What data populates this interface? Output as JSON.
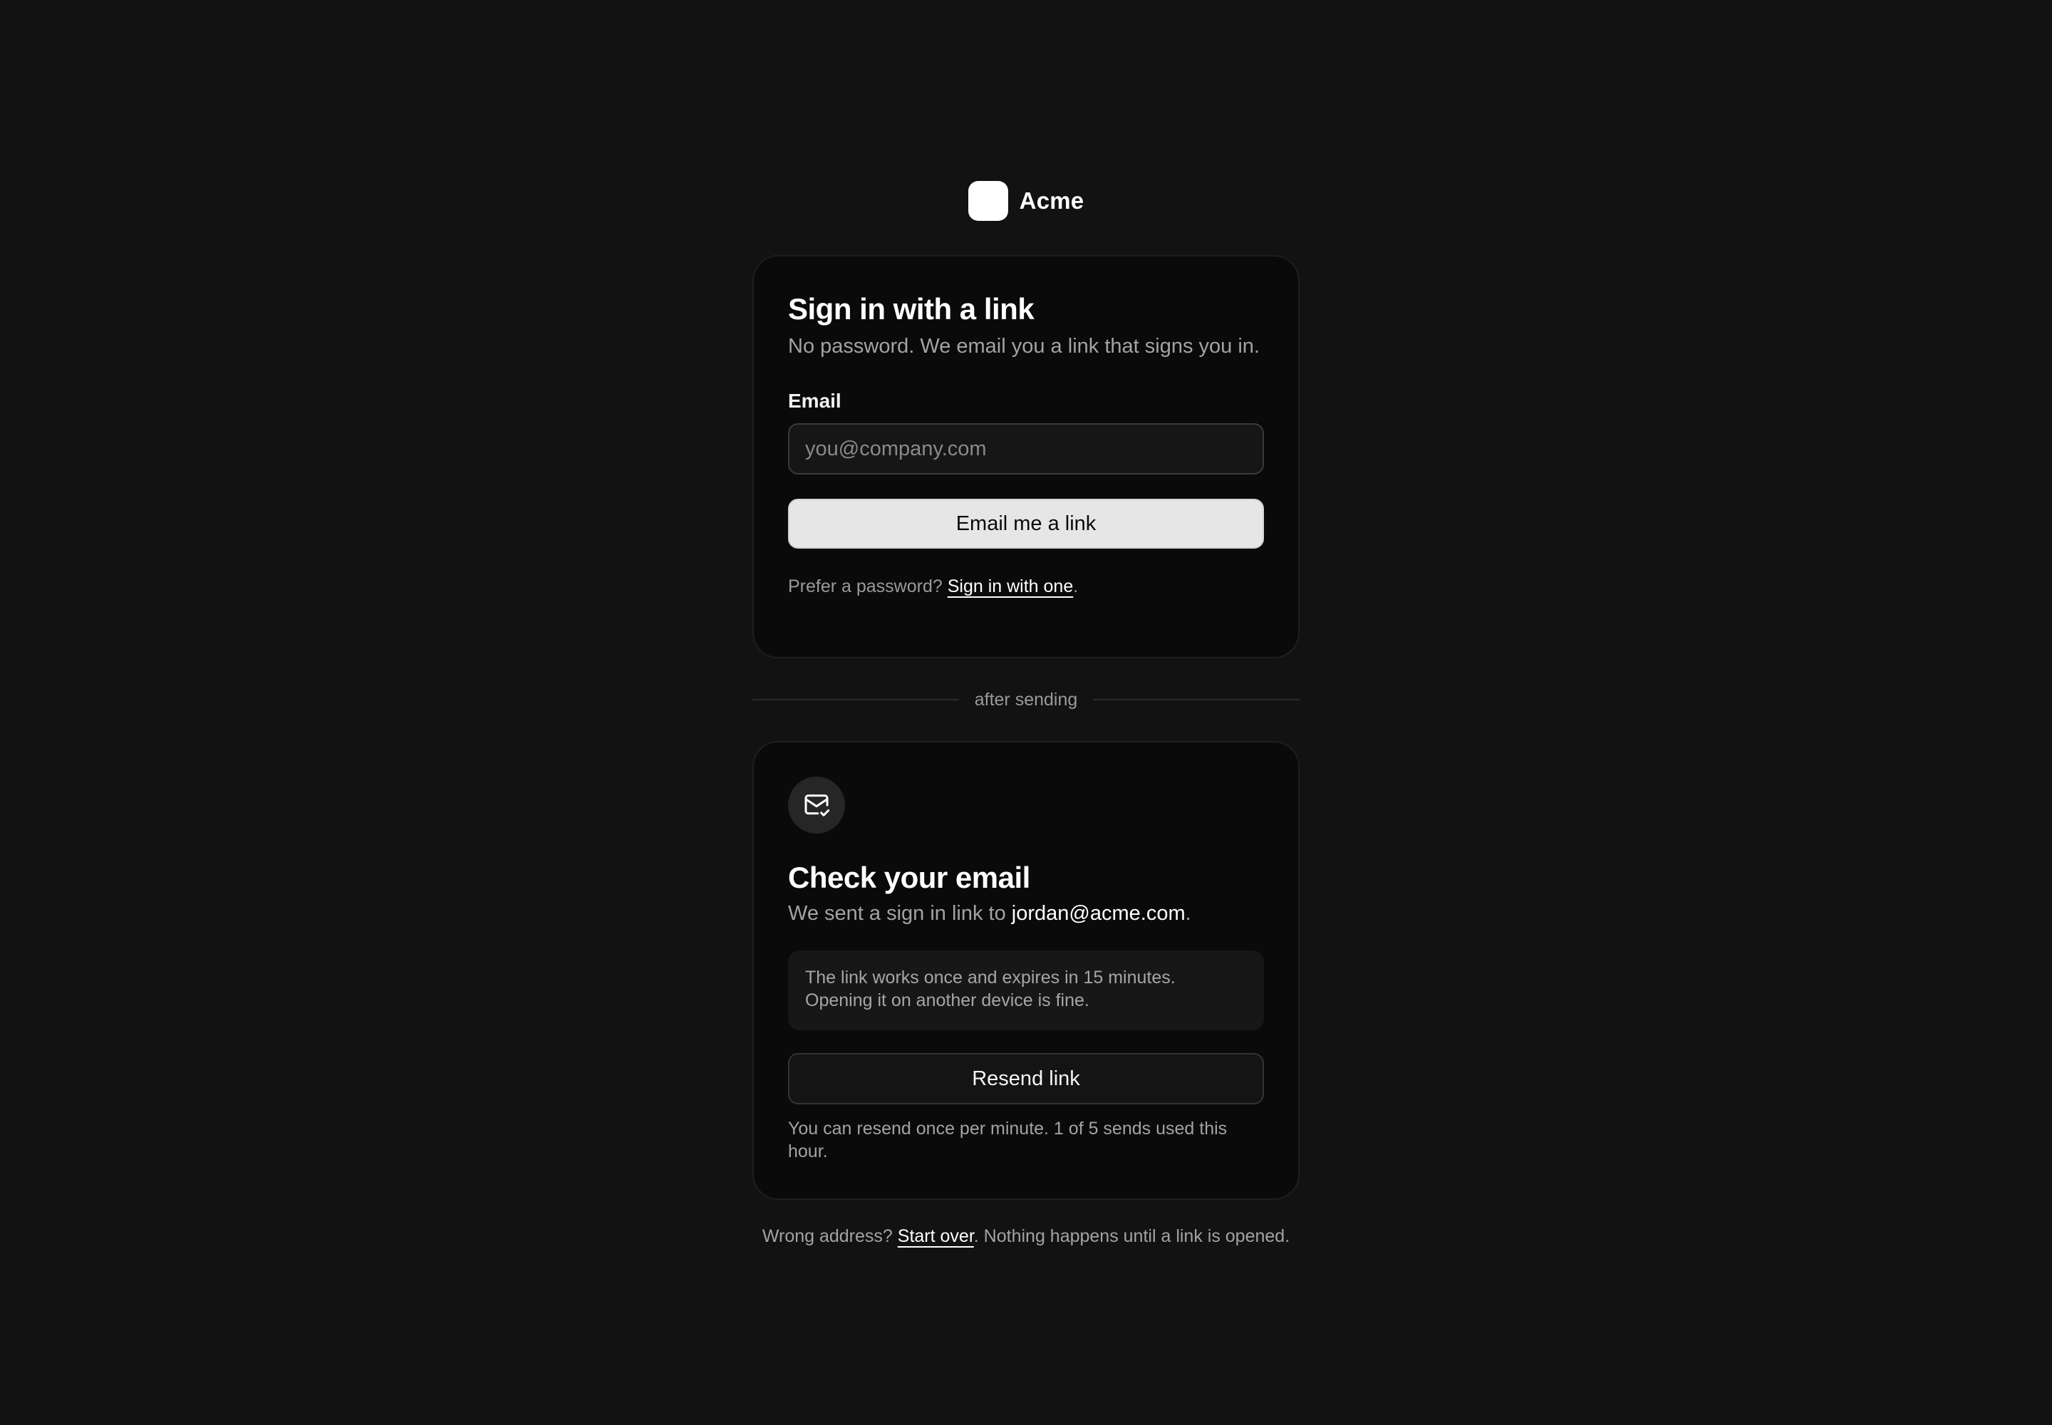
{
  "brand": {
    "name": "Acme",
    "logo_color": "#ffffff"
  },
  "signin": {
    "title": "Sign in with a link",
    "subtitle": "No password. We email you a link that signs you in.",
    "email_label": "Email",
    "email_placeholder": "you@company.com",
    "email_value": "",
    "submit_label": "Email me a link",
    "alt_prefix": "Prefer a password?",
    "alt_link": "Sign in with one",
    "alt_suffix": "."
  },
  "divider": {
    "label": "after sending"
  },
  "sent": {
    "icon": "mail-check-icon",
    "title": "Check your email",
    "subtitle_prefix": "We sent a sign in link to",
    "email": "jordan@acme.com",
    "subtitle_suffix": ".",
    "info_line1": "The link works once and expires in 15 minutes.",
    "info_line2": "Opening it on another device is fine.",
    "resend_label": "Resend link",
    "resend_note": "You can resend once per minute. 1 of 5 sends used this hour."
  },
  "footer": {
    "prefix": "Wrong address?",
    "link": "Start over",
    "suffix": ". Nothing happens until a link is opened."
  },
  "colors": {
    "background": "#121212",
    "card": "#0a0a0a",
    "primary_button": "#e6e6e6"
  }
}
